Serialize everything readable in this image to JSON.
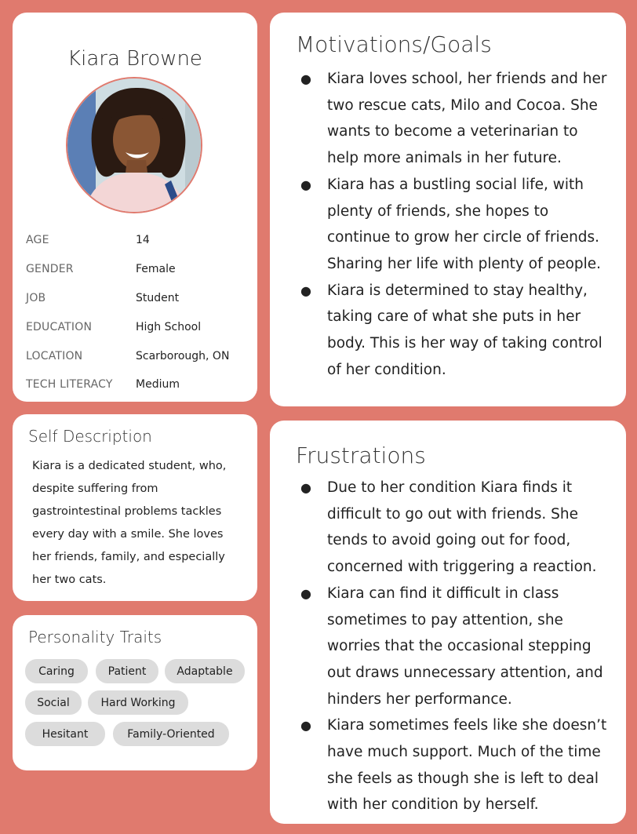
{
  "profile": {
    "name": "Kiara Browne",
    "fields": [
      {
        "label": "AGE",
        "value": "14"
      },
      {
        "label": "GENDER",
        "value": "Female"
      },
      {
        "label": "JOB",
        "value": "Student"
      },
      {
        "label": "EDUCATION",
        "value": "High School"
      },
      {
        "label": "LOCATION",
        "value": "Scarborough, ON"
      },
      {
        "label": "TECH LITERACY",
        "value": "Medium"
      }
    ]
  },
  "self_description": {
    "title": "Self Description",
    "text": "Kiara is a dedicated student, who, despite suffering from gastrointestinal problems tackles every day with a smile. She loves her friends, family, and especially her two cats."
  },
  "personality": {
    "title": "Personality Traits",
    "traits": [
      "Caring",
      "Patient",
      "Adaptable",
      "Social",
      "Hard Working",
      "Hesitant",
      "Family-Oriented"
    ]
  },
  "goals": {
    "title": "Motivations/Goals",
    "items": [
      "Kiara loves school, her friends and her two rescue cats, Milo and Cocoa. She wants to become a veterinarian to help more animals in her future.",
      "Kiara has a bustling social life, with plenty of friends, she hopes to continue to grow her circle of friends. Sharing her life with plenty of people.",
      "Kiara is determined to stay healthy, taking care of what she puts in her body. This is her way of taking control of her condition."
    ]
  },
  "frustrations": {
    "title": "Frustrations",
    "items": [
      "Due to her condition Kiara finds it difficult to go out with friends. She tends to avoid going out for food, concerned with triggering a reaction.",
      "Kiara can find it difficult in class sometimes to pay attention, she worries that the occasional stepping out draws unnecessary attention, and hinders her performance.",
      "Kiara sometimes feels like she doesn’t have much support. Much of the time she feels as though she is left to deal with her condition by herself."
    ]
  },
  "colors": {
    "background": "#e07a6e",
    "card": "#ffffff",
    "chip": "#dcdcdc"
  }
}
